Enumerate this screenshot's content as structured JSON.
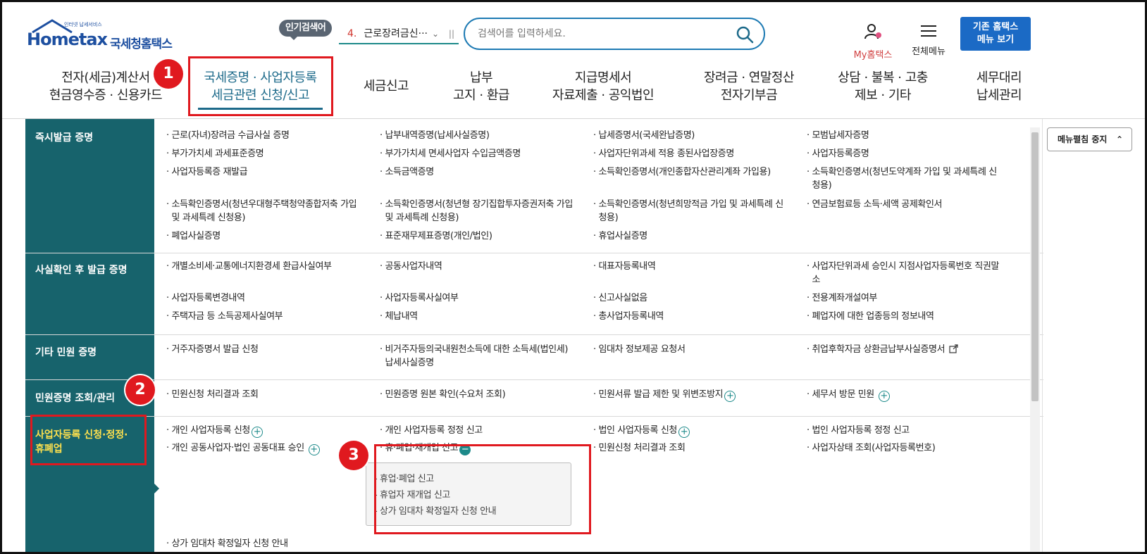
{
  "header": {
    "logo_text": "Hometax",
    "logo_kr": "국세청홈택스",
    "logo_sub": "인터넷 납세서비스",
    "popular_label": "인기검색어",
    "popular_rank": "4.",
    "popular_term": "근로장려금신···",
    "search_placeholder": "검색어를 입력하세요.",
    "my_hometax": "My홈택스",
    "all_menu": "전체메뉴",
    "old_btn_line1": "기존 홈택스",
    "old_btn_line2": "메뉴 보기"
  },
  "nav": [
    {
      "line1": "전자(세금)계산서",
      "line2": "현금영수증 · 신용카드"
    },
    {
      "line1": "국세증명 · 사업자등록",
      "line2": "세금관련 신청/신고"
    },
    {
      "line1": "세금신고",
      "line2": ""
    },
    {
      "line1": "납부",
      "line2": "고지 · 환급"
    },
    {
      "line1": "지급명세서",
      "line2": "자료제출 · 공익법인"
    },
    {
      "line1": "장려금 · 연말정산",
      "line2": "전자기부금"
    },
    {
      "line1": "상담 · 불복 · 고충",
      "line2": "제보 · 기타"
    },
    {
      "line1": "세무대리",
      "line2": "납세관리"
    }
  ],
  "callouts": [
    "1",
    "2",
    "3"
  ],
  "categories": [
    {
      "label": "즉시발급 증명"
    },
    {
      "label": "사실확인 후 발급 증명"
    },
    {
      "label": "기타 민원 증명"
    },
    {
      "label": "민원증명 조회/관리"
    },
    {
      "line1": "사업자등록 신청·정정·",
      "line2": "휴폐업"
    }
  ],
  "sec1": [
    "근로(자녀)장려금 수급사실 증명",
    "납부내역증명(납세사실증명)",
    "납세증명서(국세완납증명)",
    "모범납세자증명",
    "부가가치세 과세표준증명",
    "부가가치세 면세사업자 수입금액증명",
    "사업자단위과세 적용 종된사업장증명",
    "사업자등록증명",
    "사업자등록증 재발급",
    "소득금액증명",
    "소득확인증명서(개인종합자산관리계좌 가입용)",
    "소득확인증명서(청년도약계좌 가입 및 과세특례 신",
    "청용)",
    "소득확인증명서(청년우대형주택청약종합저축 가입",
    "소득확인증명서(청년형 장기집합투자증권저축 가입",
    "소득확인증명서(청년희망적금 가입 및 과세특례 신",
    "연금보험료등 소득·세액 공제확인서",
    "및 과세특례 신청용)",
    "및 과세특례 신청용)",
    "청용)",
    "폐업사실증명",
    "표준재무제표증명(개인/법인)",
    "휴업사실증명"
  ],
  "sec2": [
    "개별소비세·교통에너지환경세 환급사실여부",
    "공동사업자내역",
    "대표자등록내역",
    "사업자단위과세 승인시 지점사업자등록번호 직권말",
    "소",
    "사업자등록변경내역",
    "사업자등록사실여부",
    "신고사실없음",
    "전용계좌개설여부",
    "주택자금 등 소득공제사실여부",
    "체납내역",
    "총사업자등록내역",
    "폐업자에 대한 업종등의 정보내역"
  ],
  "sec3": [
    "거주자증명서 발급 신청",
    "비거주자등의국내원천소득에 대한 소득세(법인세)",
    "납세사실증명",
    "임대차 정보제공 요청서",
    "취업후학자금 상환금납부사실증명서"
  ],
  "sec4": [
    "민원신청 처리결과 조회",
    "민원증명 원본 확인(수요처 조회)",
    "민원서류 발급 제한 및 위변조방지",
    "세무서 방문 민원"
  ],
  "sec5": [
    "개인 사업자등록 신청",
    "개인 사업자등록 정정 신고",
    "법인 사업자등록 신청",
    "법인 사업자등록 정정 신고",
    "개인 공동사업자·법인 공동대표 승인",
    "휴·폐업·재개업 신고",
    "민원신청 처리결과 조회",
    "사업자상태 조회(사업자등록번호)",
    "상가 임대차 확정일자 신청 안내"
  ],
  "submenu": [
    "휴업·폐업 신고",
    "휴업자 재개업 신고",
    "상가 임대차 확정일자 신청 안내"
  ],
  "side_panel": {
    "stop_label": "메뉴펼침 중지"
  },
  "colors": {
    "sidebar": "#17636c",
    "accent": "#1d6a8a",
    "highlight": "#e0191f",
    "yellow": "#ffe14d"
  }
}
